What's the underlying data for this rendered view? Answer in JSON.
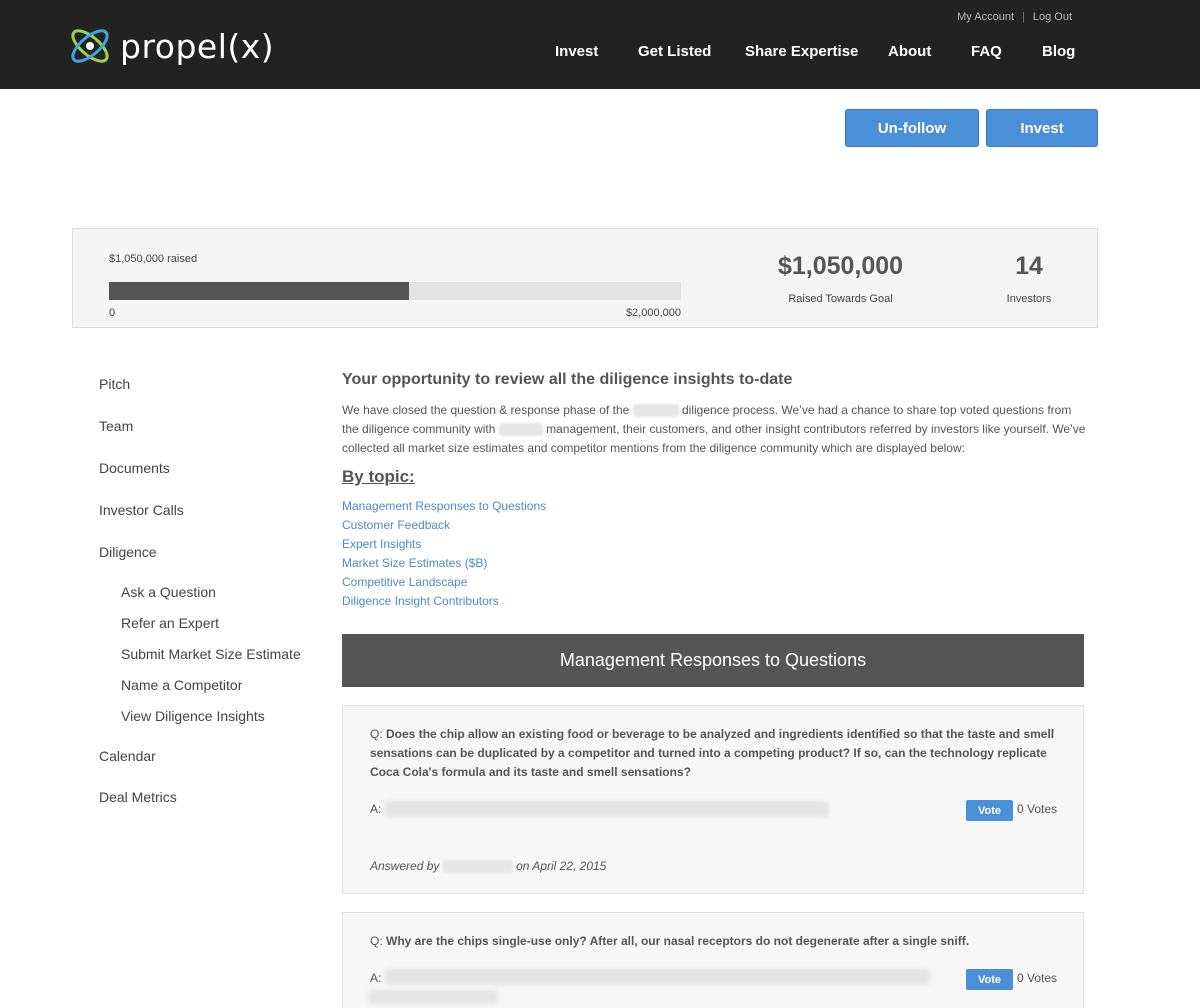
{
  "header": {
    "logo_text": "propel(x)",
    "util_links": [
      "My Account",
      "Log Out"
    ],
    "util_separator": "|",
    "nav": [
      "Invest",
      "Get Listed",
      "Share Expertise",
      "About",
      "FAQ",
      "Blog"
    ]
  },
  "actions": {
    "unfollow": "Un-follow",
    "invest": "Invest"
  },
  "funding": {
    "raised_label": "$1,050,000 raised",
    "progress_fraction": 0.525,
    "min_label": "0",
    "max_label": "$2,000,000",
    "raised_amount": "$1,050,000",
    "raised_caption": "Raised Towards Goal",
    "investors_count": "14",
    "investors_caption": "Investors"
  },
  "sidebar": {
    "items": [
      "Pitch",
      "Team",
      "Documents",
      "Investor Calls",
      "Diligence"
    ],
    "sub_items": [
      "Ask a Question",
      "Refer an Expert",
      "Submit Market Size Estimate",
      "Name a Competitor",
      "View Diligence Insights"
    ],
    "after_items": [
      "Calendar",
      "Deal Metrics"
    ]
  },
  "main": {
    "title": "Your opportunity to review all the diligence insights to-date",
    "intro_part1": "We have closed the question & response phase of the",
    "intro_part2": "diligence process. We’ve had a chance to share top voted questions from the diligence community with",
    "intro_part3": "management, their customers, and other insight contributors referred by investors like yourself. We’ve collected all market size estimates and competitor mentions from the diligence community which are displayed below:",
    "topics_heading": "By topic:",
    "topics": [
      "Management Responses to Questions",
      "Customer Feedback",
      "Expert Insights",
      "Market Size Estimates ($B)",
      "Competitive Landscape",
      "Diligence Insight Contributors"
    ],
    "section_title": "Management Responses to Questions"
  },
  "questions": [
    {
      "q_prefix": "Q:",
      "text": "Does the chip allow an existing food or beverage to be analyzed and ingredients identified so that the taste and smell sensations can be duplicated by a competitor and turned into a competing product? If so, can the technology replicate Coca Cola's formula and its taste and smell sensations?",
      "a_prefix": "A:",
      "vote_label": "Vote",
      "votes": "0 Votes",
      "answered_by": "Answered by",
      "answered_on": "on April 22, 2015"
    },
    {
      "q_prefix": "Q:",
      "text": "Why are the chips single-use only? After all, our nasal receptors do not degenerate after a single sniff.",
      "a_prefix": "A:",
      "vote_label": "Vote",
      "votes": "0 Votes"
    }
  ],
  "colors": {
    "header_bg": "#222222",
    "accent": "#4a90d9",
    "link": "#4a8ccc",
    "band": "#555555"
  }
}
